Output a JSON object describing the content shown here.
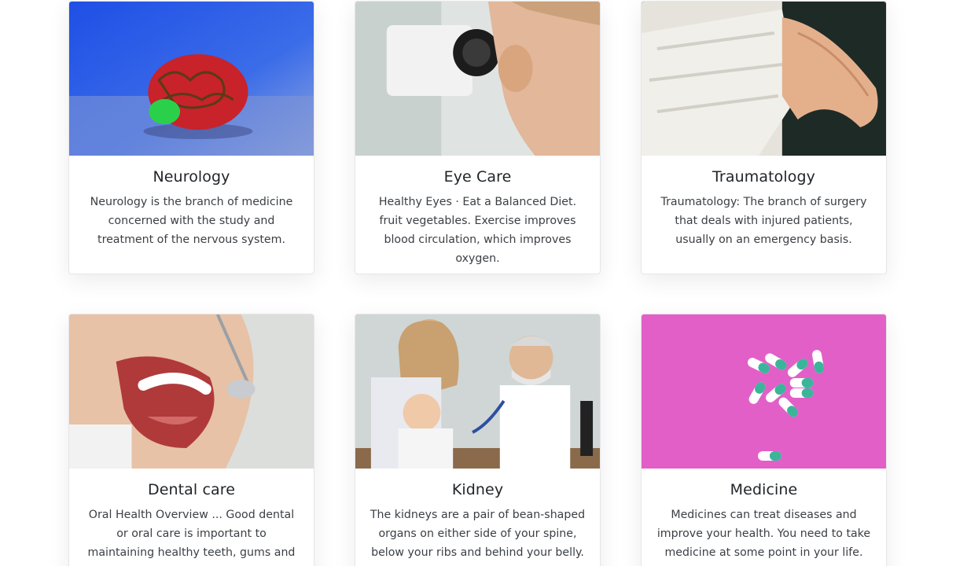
{
  "services": [
    {
      "title": "Neurology",
      "description": "Neurology is the branch of medicine concerned with the study and treatment of the nervous system.",
      "image_icon": "brain-image"
    },
    {
      "title": "Eye Care",
      "description": "Healthy Eyes · Eat a Balanced Diet. fruit vegetables. Exercise improves blood circulation, which improves oxygen.",
      "image_icon": "eye-exam-image"
    },
    {
      "title": "Traumatology",
      "description": "Traumatology: The branch of surgery that deals with injured patients, usually on an emergency basis.",
      "image_icon": "bandaged-hand-image"
    },
    {
      "title": "Dental care",
      "description": "Oral Health Overview ... Good dental or oral care is important to maintaining healthy teeth, gums and tongue.",
      "image_icon": "dental-exam-image"
    },
    {
      "title": "Kidney",
      "description": "The kidneys are a pair of bean-shaped organs on either side of your spine, below your ribs and behind your belly.",
      "image_icon": "doctor-child-image"
    },
    {
      "title": "Medicine",
      "description": "Medicines can treat diseases and improve your health. You need to take medicine at some point in your life.",
      "image_icon": "pills-image"
    }
  ],
  "colors": {
    "card_border": "#e6e6e6",
    "title": "#212529",
    "text": "#3b3f44",
    "medicine_bg": "#e25fc8",
    "neurology_bg": "#2f5fe0"
  }
}
